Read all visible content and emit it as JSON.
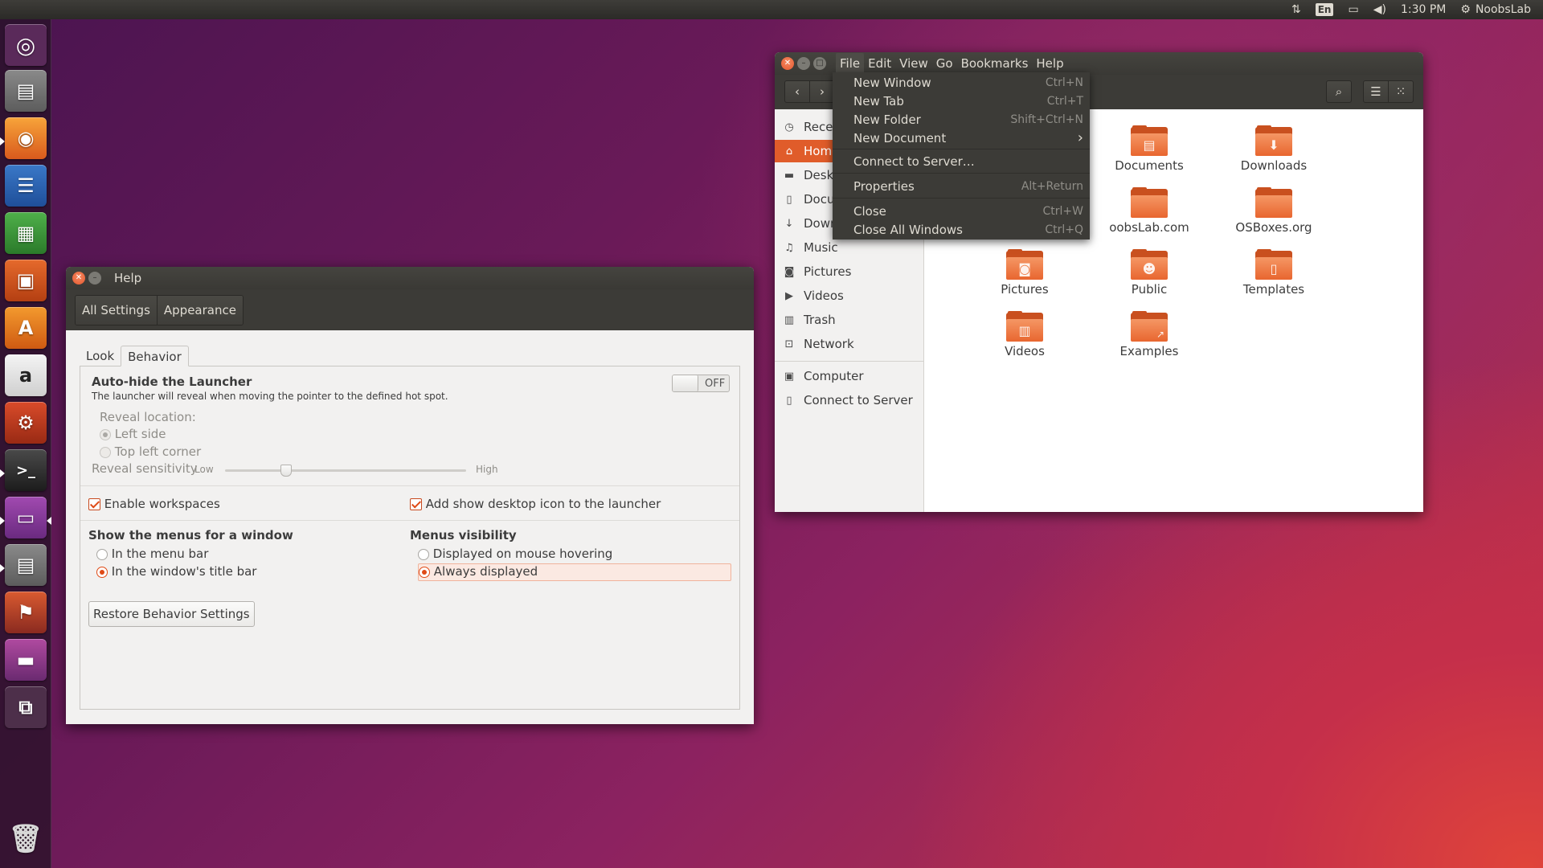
{
  "top_panel": {
    "kbd_layout": "En",
    "time": "1:30 PM",
    "user": "NoobsLab",
    "icons": [
      "network-transfer-icon",
      "keyboard-icon",
      "battery-icon",
      "volume-icon",
      "gear-icon"
    ]
  },
  "launcher": {
    "items": [
      "ubuntu-dash",
      "files",
      "firefox",
      "libreoffice-writer",
      "libreoffice-calc",
      "libreoffice-impress",
      "ubuntu-software",
      "amazon",
      "system-settings",
      "terminal",
      "display-settings",
      "files-2",
      "maps",
      "workspace-switcher",
      "show-desktop",
      "trash"
    ]
  },
  "help_window": {
    "title": "Help",
    "toolbar": {
      "all_settings": "All Settings",
      "appearance": "Appearance"
    },
    "tabs": {
      "look": "Look",
      "behavior": "Behavior"
    },
    "autohide": {
      "title": "Auto-hide the Launcher",
      "desc": "The launcher will reveal when moving the pointer to the defined hot spot.",
      "toggle": "OFF",
      "reveal_location": "Reveal location:",
      "left_side": "Left side",
      "top_left": "Top left corner",
      "sensitivity": "Reveal sensitivity",
      "low": "Low",
      "high": "High",
      "sensitivity_value": 0.24
    },
    "enable_workspaces": "Enable workspaces",
    "show_desktop_icon": "Add show desktop icon to the launcher",
    "menus_for_window": "Show the menus for a window",
    "in_menu_bar": "In the menu bar",
    "in_title_bar": "In the window's title bar",
    "menus_visibility": "Menus visibility",
    "on_hover": "Displayed on mouse hovering",
    "always": "Always displayed",
    "restore": "Restore Behavior Settings"
  },
  "files_window": {
    "menu": [
      "File",
      "Edit",
      "View",
      "Go",
      "Bookmarks",
      "Help"
    ],
    "sidebar": [
      {
        "label": "Recent",
        "icon": "clock-icon"
      },
      {
        "label": "Home",
        "icon": "home-icon"
      },
      {
        "label": "Desktop",
        "icon": "folder-icon"
      },
      {
        "label": "Documents",
        "icon": "document-icon"
      },
      {
        "label": "Downloads",
        "icon": "download-icon"
      },
      {
        "label": "Music",
        "icon": "music-icon"
      },
      {
        "label": "Pictures",
        "icon": "camera-icon"
      },
      {
        "label": "Videos",
        "icon": "video-icon"
      },
      {
        "label": "Trash",
        "icon": "trash-icon"
      },
      {
        "label": "Network",
        "icon": "network-icon"
      },
      {
        "label": "Computer",
        "icon": "computer-icon"
      },
      {
        "label": "Connect to Server",
        "icon": "server-icon"
      }
    ],
    "folders": [
      "Documents",
      "Downloads",
      "oobsLab.com",
      "OSBoxes.org",
      "Pictures",
      "Public",
      "Templates",
      "Videos",
      "Examples"
    ],
    "file_menu": [
      {
        "label": "New Window",
        "accel": "Ctrl+N"
      },
      {
        "label": "New Tab",
        "accel": "Ctrl+T"
      },
      {
        "label": "New Folder",
        "accel": "Shift+Ctrl+N"
      },
      {
        "label": "New Document",
        "accel": "›"
      },
      {
        "label": "Connect to Server…",
        "accel": ""
      },
      {
        "label": "Properties",
        "accel": "Alt+Return"
      },
      {
        "label": "Close",
        "accel": "Ctrl+W"
      },
      {
        "label": "Close All Windows",
        "accel": "Ctrl+Q"
      }
    ]
  },
  "colors": {
    "accent": "#e05c2a",
    "panel": "#3c3b37"
  }
}
